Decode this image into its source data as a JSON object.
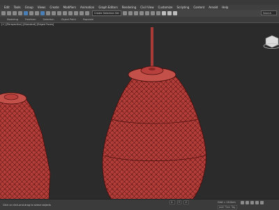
{
  "menu": [
    {
      "label": "Edit"
    },
    {
      "label": "Tools"
    },
    {
      "label": "Group"
    },
    {
      "label": "Views"
    },
    {
      "label": "Create"
    },
    {
      "label": "Modifiers"
    },
    {
      "label": "Animation"
    },
    {
      "label": "Graph Editors"
    },
    {
      "label": "Rendering"
    },
    {
      "label": "Civil View"
    },
    {
      "label": "Customize"
    },
    {
      "label": "Scripting"
    },
    {
      "label": "Content"
    },
    {
      "label": "Arnold"
    },
    {
      "label": "Help"
    }
  ],
  "toolbar": {
    "selection_set": "Create Selection Set"
  },
  "search": {
    "placeholder": "Search"
  },
  "ribbon": {
    "labels": [
      "Modeling",
      "Freeform",
      "Selection",
      "Object Paint",
      "Populate"
    ]
  },
  "viewport": {
    "label": "[+] [Perspective] [Standard] [Edged Faces]"
  },
  "status": {
    "prompt": "Click or click-and-drag to select objects",
    "x": "X:",
    "y": "Y:",
    "z": "Z:",
    "grid": "Grid = 10.0cm",
    "add_time_tag": "Add Time Tag"
  },
  "colors": {
    "mesh": "#b8403c",
    "wire": "#5a1412",
    "background": "#2b2b2b"
  }
}
